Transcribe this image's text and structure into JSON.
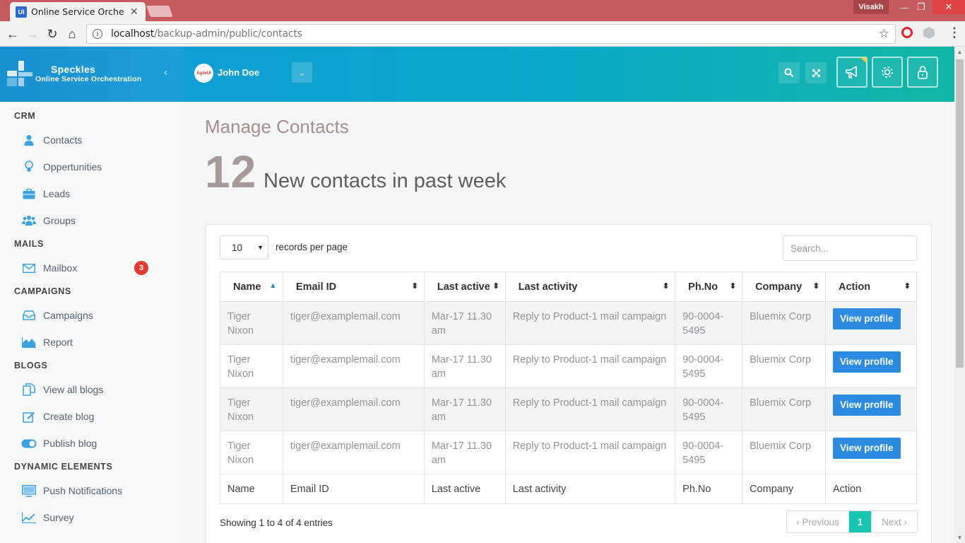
{
  "browser": {
    "tab_title": "Online Service Orchestra",
    "tab_favicon": "UI",
    "window_user": "Visakh",
    "url_host": "localhost",
    "url_path": "/backup-admin/public/contacts"
  },
  "brand": {
    "title": "Speckles",
    "subtitle": "Online Service Orchestration"
  },
  "topbar": {
    "user_name": "John Doe",
    "avatar_text": "AgileUI",
    "icons": [
      "search-icon",
      "expand-icon",
      "megaphone-icon",
      "gear-icon",
      "lock-icon"
    ]
  },
  "sidebar": {
    "sections": [
      {
        "title": "CRM"
      },
      {
        "title": "MAILS"
      },
      {
        "title": "CAMPAIGNS"
      },
      {
        "title": "BLOGS"
      },
      {
        "title": "DYNAMIC ELEMENTS"
      }
    ],
    "items": [
      {
        "label": "Contacts",
        "icon": "user-icon"
      },
      {
        "label": "Oppertunities",
        "icon": "lightbulb-icon"
      },
      {
        "label": "Leads",
        "icon": "briefcase-icon"
      },
      {
        "label": "Groups",
        "icon": "users-icon"
      },
      {
        "label": "Mailbox",
        "icon": "envelope-icon",
        "badge": "3"
      },
      {
        "label": "Campaigns",
        "icon": "inbox-icon"
      },
      {
        "label": "Report",
        "icon": "area-chart-icon"
      },
      {
        "label": "View all blogs",
        "icon": "copy-icon"
      },
      {
        "label": "Create blog",
        "icon": "edit-icon"
      },
      {
        "label": "Publish blog",
        "icon": "toggle-icon"
      },
      {
        "label": "Push Notifications",
        "icon": "monitor-icon"
      },
      {
        "label": "Survey",
        "icon": "line-chart-icon"
      }
    ]
  },
  "main": {
    "page_title": "Manage Contacts",
    "stat_number": "12",
    "stat_text": "New contacts in past week",
    "records_per_page": "10",
    "records_label": "records per page",
    "search_placeholder": "Search...",
    "columns": [
      "Name",
      "Email ID",
      "Last active",
      "Last activity",
      "Ph.No",
      "Company",
      "Action"
    ],
    "rows": [
      {
        "name": "Tiger Nixon",
        "email": "tiger@examplemail.com",
        "last_active": "Mar-17 11.30 am",
        "activity": "Reply to Product-1 mail campaign",
        "phone": "90-0004-5495",
        "company": "Bluemix Corp",
        "action": "View profile"
      },
      {
        "name": "Tiger Nixon",
        "email": "tiger@examplemail.com",
        "last_active": "Mar-17 11.30 am",
        "activity": "Reply to Product-1 mail campaign",
        "phone": "90-0004-5495",
        "company": "Bluemix Corp",
        "action": "View profile"
      },
      {
        "name": "Tiger Nixon",
        "email": "tiger@examplemail.com",
        "last_active": "Mar-17 11.30 am",
        "activity": "Reply to Product-1 mail campaign",
        "phone": "90-0004-5495",
        "company": "Bluemix Corp",
        "action": "View profile"
      },
      {
        "name": "Tiger Nixon",
        "email": "tiger@examplemail.com",
        "last_active": "Mar-17 11.30 am",
        "activity": "Reply to Product-1 mail campaign",
        "phone": "90-0004-5495",
        "company": "Bluemix Corp",
        "action": "View profile"
      }
    ],
    "info": "Showing 1 to 4 of 4 entries",
    "pagination": {
      "prev": "‹ Previous",
      "current": "1",
      "next": "Next ›"
    }
  },
  "colors": {
    "accent": "#2a8be0",
    "header_start": "#0f9fd5",
    "header_end": "#13b6a6",
    "badge": "#e33b2f",
    "page_current": "#16c6b0"
  }
}
